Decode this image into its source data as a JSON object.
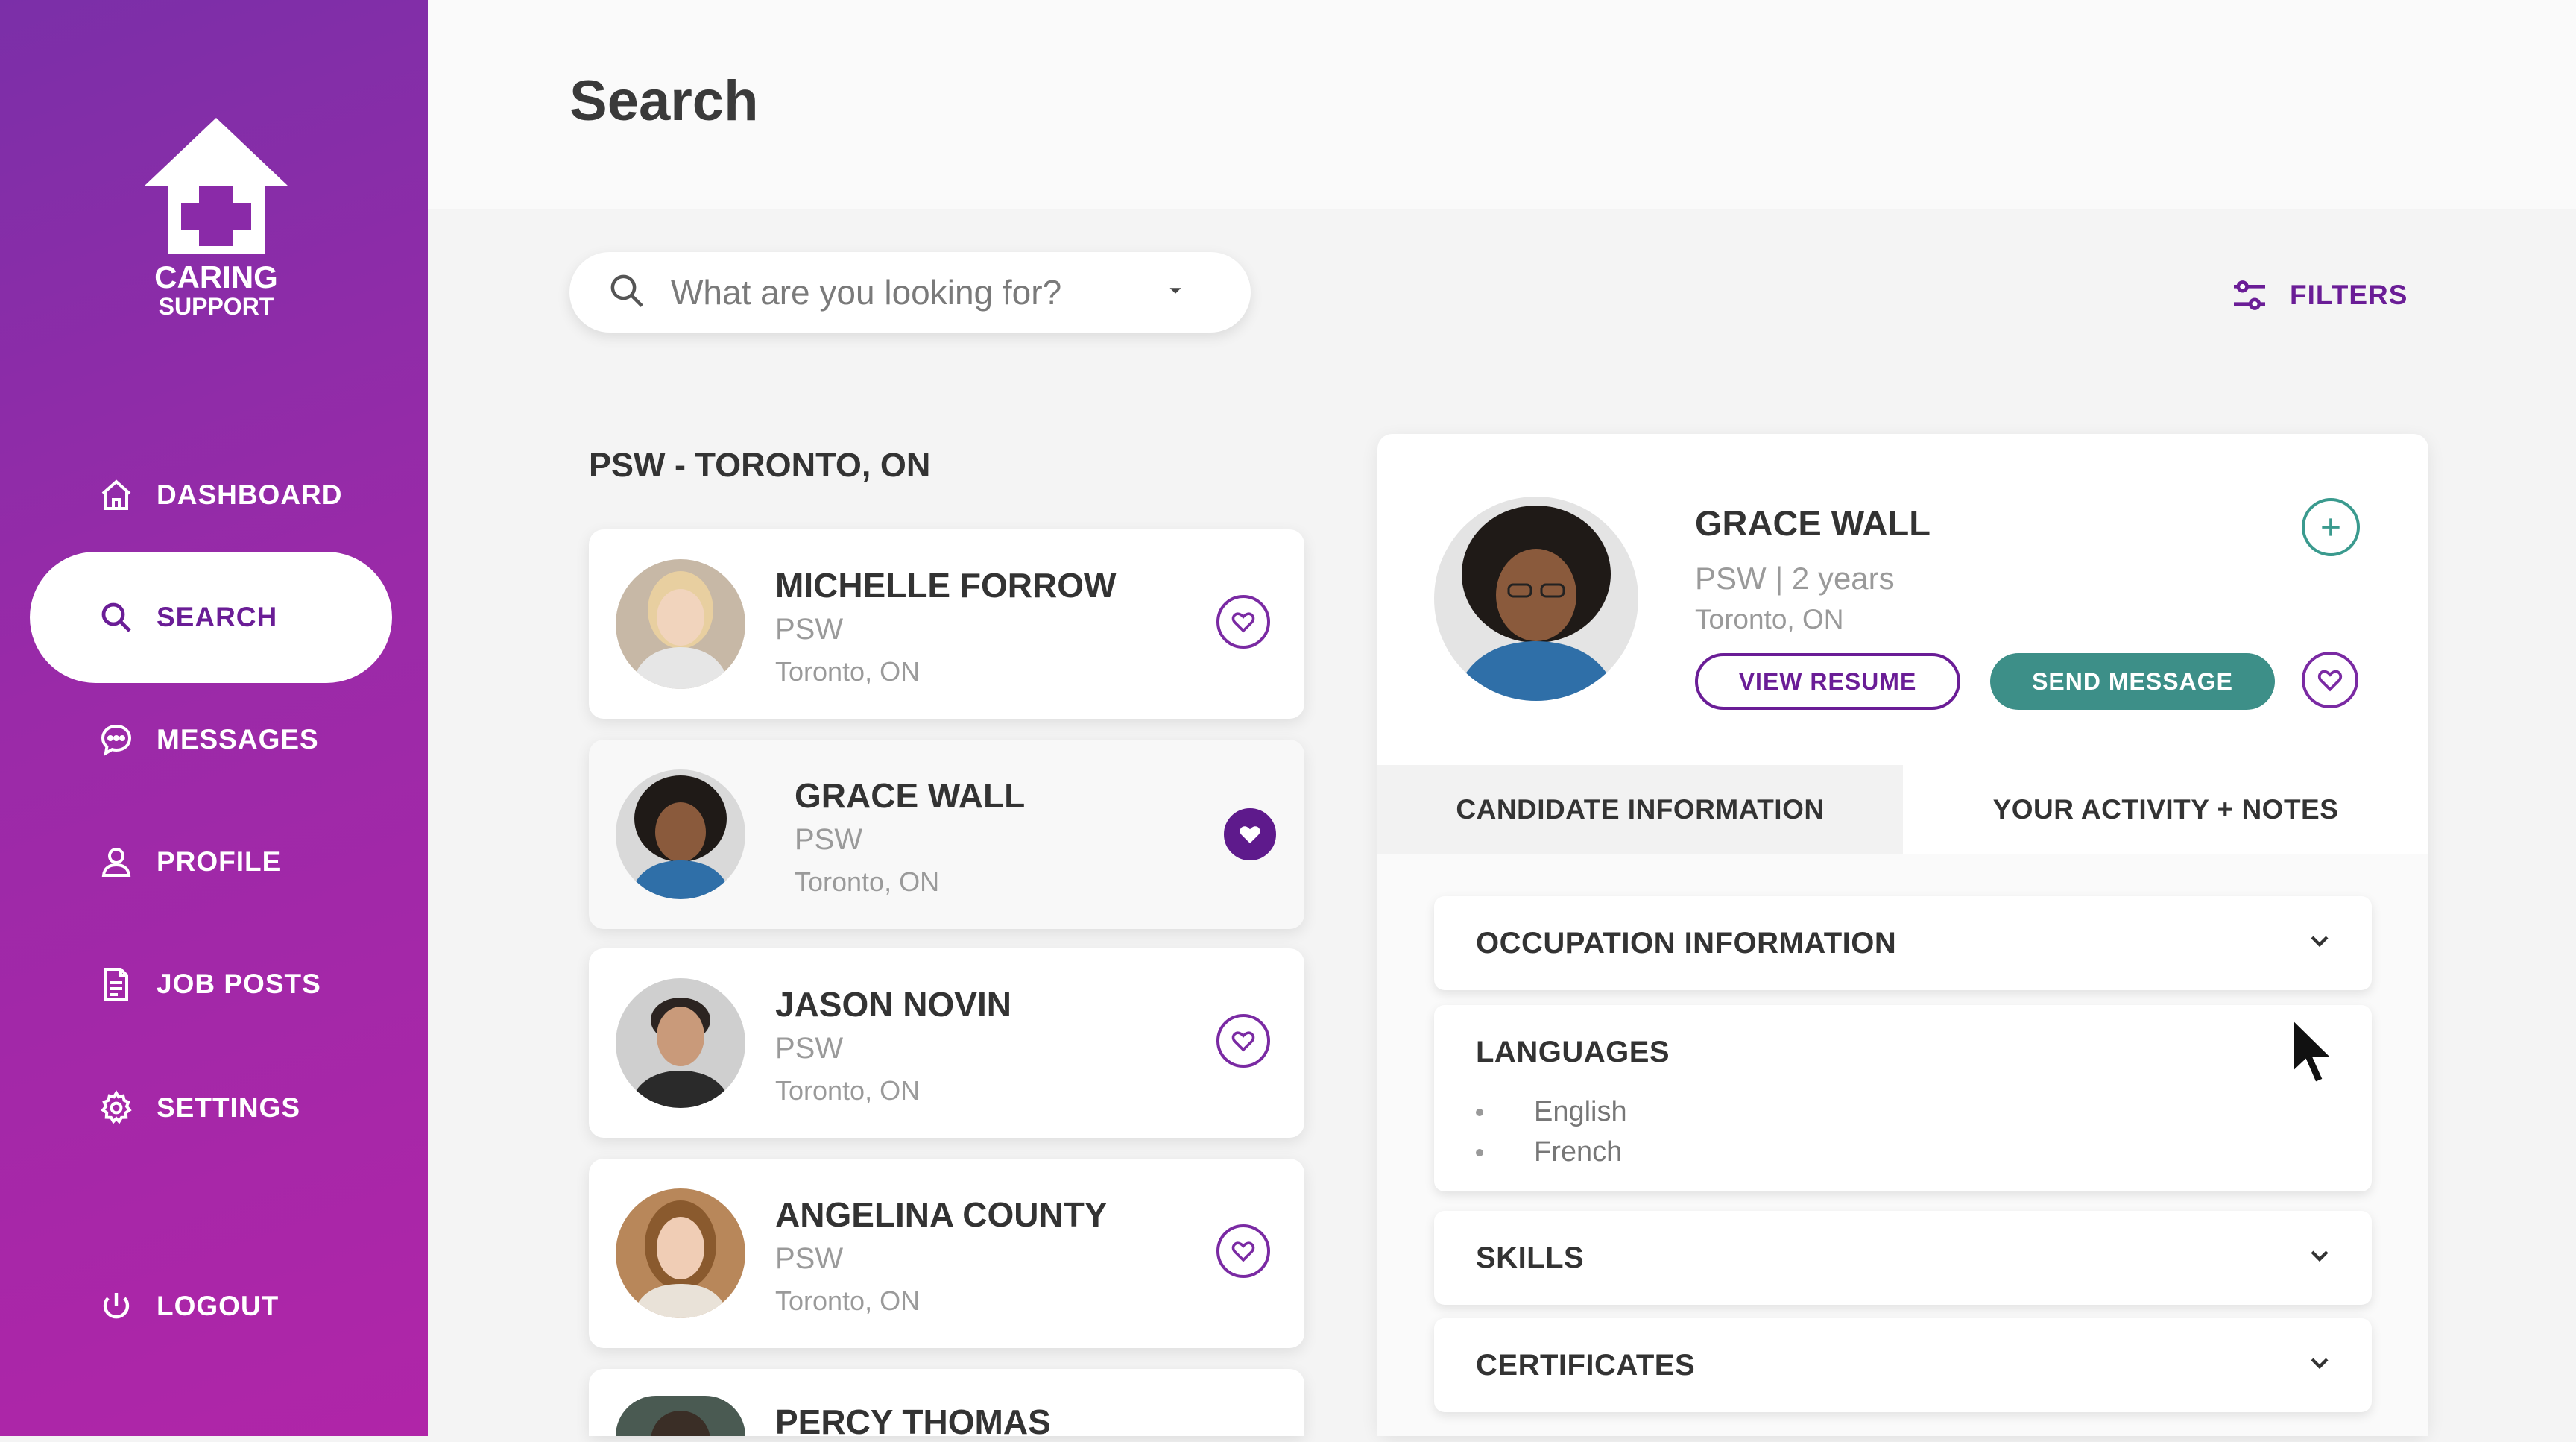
{
  "brand": {
    "line1": "CARING",
    "line2": "SUPPORT"
  },
  "nav": [
    {
      "label": "DASHBOARD",
      "icon": "home-icon"
    },
    {
      "label": "SEARCH",
      "icon": "search-icon",
      "active": true
    },
    {
      "label": "MESSAGES",
      "icon": "chat-icon"
    },
    {
      "label": "PROFILE",
      "icon": "user-icon"
    },
    {
      "label": "JOB POSTS",
      "icon": "document-icon"
    },
    {
      "label": "SETTINGS",
      "icon": "gear-icon"
    },
    {
      "label": "LOGOUT",
      "icon": "power-icon"
    }
  ],
  "page": {
    "title": "Search"
  },
  "search": {
    "placeholder": "What are you looking for?"
  },
  "filters": {
    "label": "FILTERS"
  },
  "results": {
    "heading": "PSW - TORONTO, ON",
    "candidates": [
      {
        "name": "MICHELLE FORROW",
        "role": "PSW",
        "location": "Toronto, ON",
        "favorited": false
      },
      {
        "name": "GRACE WALL",
        "role": "PSW",
        "location": "Toronto, ON",
        "favorited": true
      },
      {
        "name": "JASON NOVIN",
        "role": "PSW",
        "location": "Toronto, ON",
        "favorited": false
      },
      {
        "name": "ANGELINA COUNTY",
        "role": "PSW",
        "location": "Toronto, ON",
        "favorited": false
      },
      {
        "name": "PERCY THOMAS"
      }
    ]
  },
  "detail": {
    "name": "GRACE WALL",
    "role": "PSW | 2 years",
    "location": "Toronto, ON",
    "view_resume": "VIEW RESUME",
    "send_message": "SEND MESSAGE",
    "tabs": [
      "CANDIDATE INFORMATION",
      "YOUR ACTIVITY + NOTES"
    ],
    "sections": {
      "occupation": "OCCUPATION INFORMATION",
      "languages": {
        "title": "LANGUAGES",
        "items": [
          "English",
          "French"
        ]
      },
      "skills": "SKILLS",
      "certificates": "CERTIFICATES"
    }
  },
  "colors": {
    "purple": "#6a1d96",
    "teal": "#3d8f88"
  }
}
